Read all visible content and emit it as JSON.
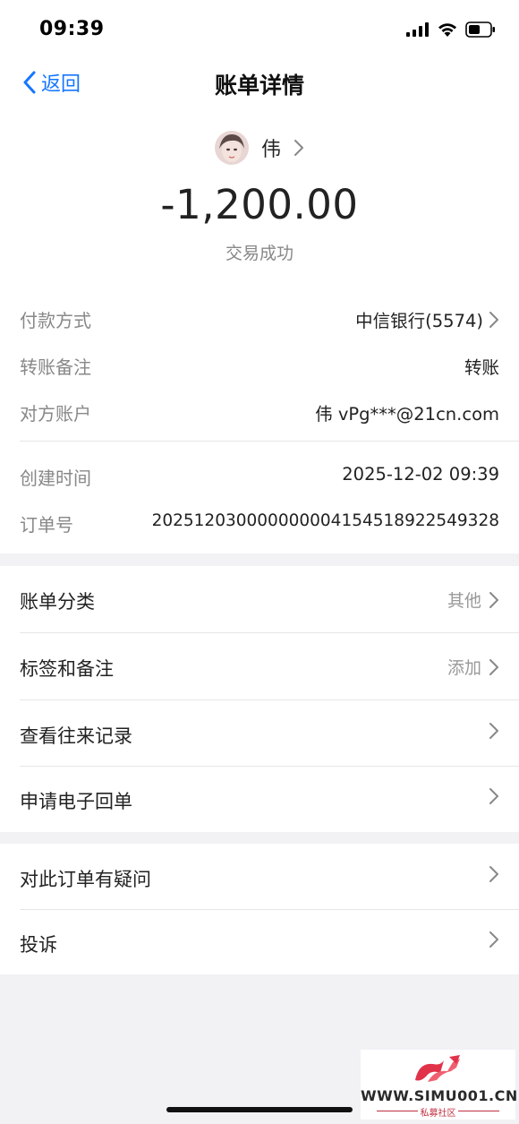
{
  "status_bar": {
    "time": "09:39"
  },
  "nav": {
    "back_label": "返回",
    "title": "账单详情"
  },
  "header": {
    "payee_name": "伟",
    "amount": "-1,200.00",
    "status": "交易成功"
  },
  "details": {
    "payment_method": {
      "label": "付款方式",
      "value": "中信银行(5574)"
    },
    "transfer_note": {
      "label": "转账备注",
      "value": "转账"
    },
    "counterparty": {
      "label": "对方账户",
      "value": "伟 vPg***@21cn.com"
    },
    "created_time": {
      "label": "创建时间",
      "value": "2025-12-02 09:39"
    },
    "order_no": {
      "label": "订单号",
      "value": "20251203000000000415451892254932​8"
    }
  },
  "menu1": [
    {
      "label": "账单分类",
      "value": "其他"
    },
    {
      "label": "标签和备注",
      "value": "添加"
    },
    {
      "label": "查看往来记录",
      "value": ""
    },
    {
      "label": "申请电子回单",
      "value": ""
    }
  ],
  "menu2": [
    {
      "label": "对此订单有疑问",
      "value": ""
    },
    {
      "label": "投诉",
      "value": ""
    }
  ],
  "watermark": {
    "url": "WWW.SIMU001.CN",
    "sub": "私募社区"
  },
  "colors": {
    "accent": "#1677ff",
    "background": "#f2f2f5",
    "brand_red": "#e0334a"
  }
}
